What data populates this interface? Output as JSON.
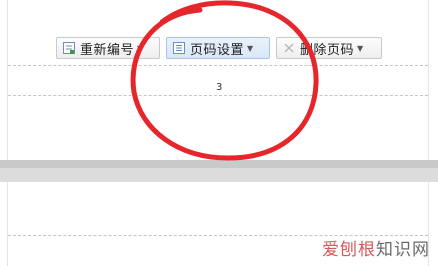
{
  "toolbar": {
    "buttons": [
      {
        "label": "重新编号"
      },
      {
        "label": "页码设置"
      },
      {
        "label": "删除页码"
      }
    ]
  },
  "page": {
    "page_number": "3"
  },
  "annotation": {
    "shape": "circle",
    "color": "#e5262a"
  },
  "watermark": {
    "brand": "爱刨根",
    "site": "知识网"
  }
}
